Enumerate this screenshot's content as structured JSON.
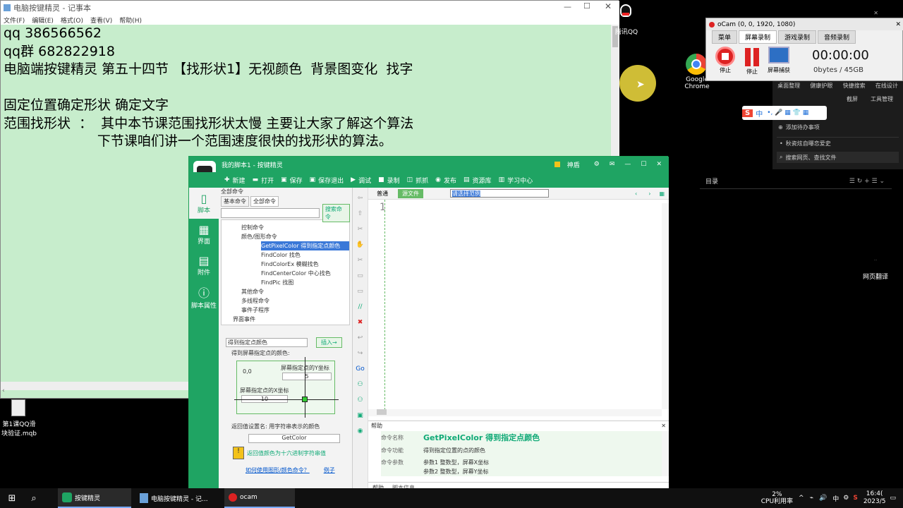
{
  "notepad": {
    "title": "电脑按键精灵 - 记事本",
    "menu": [
      "文件(F)",
      "编辑(E)",
      "格式(O)",
      "查看(V)",
      "帮助(H)"
    ],
    "text": "qq 386566562\nqq群 682822918\n电脑端按键精灵 第五十四节 【找形状1】无视颜色  背景图变化  找字\n\n固定位置确定形状 确定文字\n范围找形状  ：  其中本节课范围找形状太慢 主要让大家了解这个算法\n                      下节课咱们讲一个范围速度很快的找形状的算法。"
  },
  "desktop": {
    "qq_label": "腾讯QQ",
    "chrome_label": "Google Chrome",
    "file_label": "第1课QQ滑块验证.mqb",
    "web_label": "网页翻译"
  },
  "ocam": {
    "title": "oCam (0, 0, 1920, 1080)",
    "tabs": [
      "菜单",
      "屏幕录制",
      "游戏录制",
      "音频录制"
    ],
    "buttons": [
      "停止",
      "停止",
      "屏幕捕获"
    ],
    "timer": "00:00:00",
    "size": "0bytes / 45GB"
  },
  "side_panel": {
    "row1": [
      "桌面整理",
      "健康护眼",
      "快捷搜索",
      "在线设计"
    ],
    "row2": [
      "截屏",
      "工具管理"
    ],
    "add_todo": "添加待办事项",
    "news": "秋瓷炫自曝恋爱史",
    "search": "搜索网页、查找文件",
    "toc": "目录"
  },
  "aj": {
    "title": "我的脚本1 - 按键精灵",
    "vip": "神盾",
    "toolbar": [
      "新建",
      "打开",
      "保存",
      "保存退出",
      "调试",
      "录制",
      "抓抓",
      "发布",
      "资源库",
      "学习中心"
    ],
    "left": [
      "脚本",
      "界面",
      "附件",
      "脚本属性"
    ],
    "cmd_panel_title": "全部命令",
    "cmd_tabs": [
      "基本命令",
      "全部命令"
    ],
    "search_btn": "搜索命令",
    "tree": [
      "控制命令",
      "颜色/图形命令",
      "GetPixelColor 得到指定点颜色",
      "FindColor 找色",
      "FindColorEx 模糊找色",
      "FindCenterColor 中心找色",
      "FindPic 找图",
      "其他命令",
      "多线程命令",
      "事件子程序",
      "界面事件"
    ],
    "cmd_select": "得到指定点颜色",
    "insert_btn": "插入→",
    "get_label": "得到屏幕指定点的颜色:",
    "y_label": "屏幕指定点的Y坐标",
    "y_val": "5",
    "x_label": "屏幕指定点的X坐标",
    "x_val": "10",
    "origin": "0,0",
    "return_label": "返回值设置名: 用字符串表示的颜色",
    "return_val": "GetColor",
    "return_note": "返回值颜色为十六进制字符串值",
    "link1": "如何使用图形/颜色命令？",
    "link2": "例子",
    "view_tabs": [
      "普通",
      "源文件"
    ],
    "dropdown": "请选择范例",
    "line_no": "1",
    "help_title": "帮助",
    "help_name_label": "命令名称",
    "help_name": "GetPixelColor 得到指定点颜色",
    "help_func_label": "命令功能",
    "help_func": "得到指定位置的点的颜色",
    "help_param_label": "命令参数",
    "help_param1": "参数1 整数型，屏幕X坐标",
    "help_param2": "参数2 整数型，屏幕Y坐标",
    "bottom_tabs": [
      "帮助",
      "脚本信息"
    ]
  },
  "taskbar": {
    "apps": [
      "按键精灵",
      "电脑按键精灵 - 记...",
      "ocam"
    ],
    "cpu_pct": "2%",
    "cpu_label": "CPU利用率",
    "ime": "中",
    "time": "16:4(",
    "date": "2023/5"
  }
}
